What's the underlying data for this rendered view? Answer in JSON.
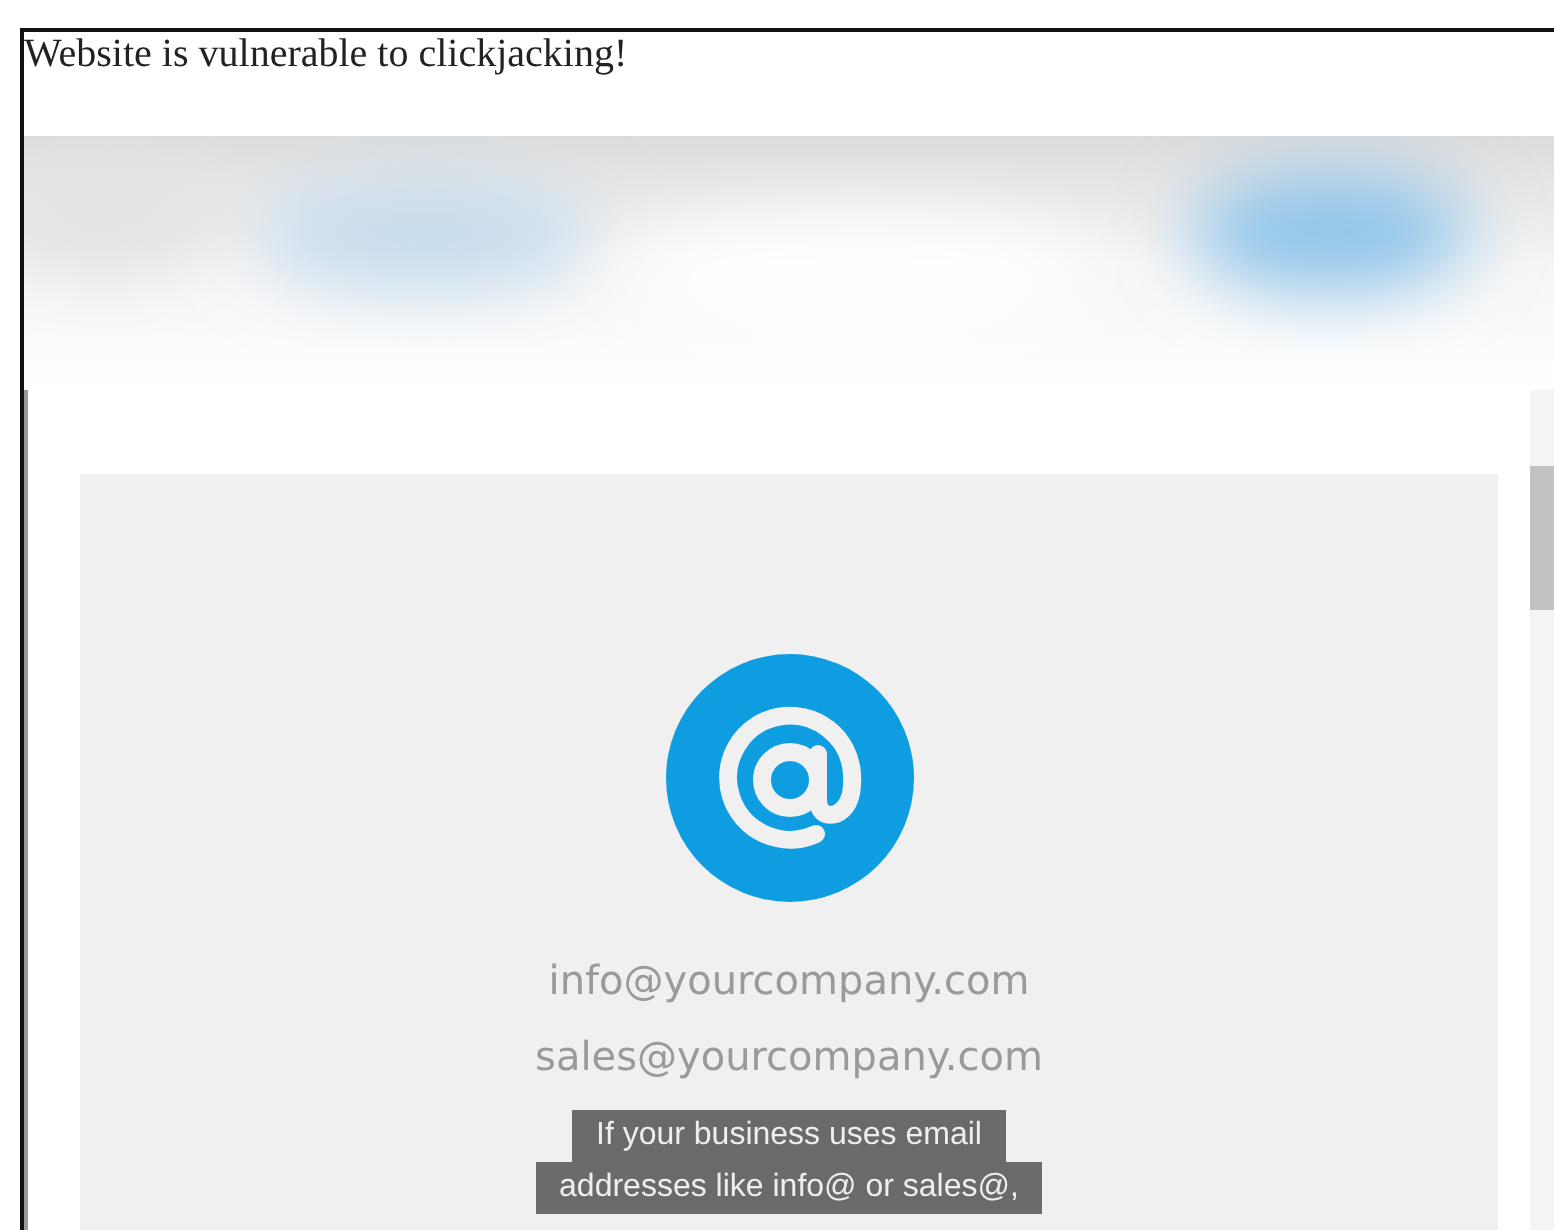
{
  "heading": "Website is vulnerable to clickjacking!",
  "framed_page": {
    "emails": [
      "info@yourcompany.com",
      "sales@yourcompany.com"
    ],
    "caption_lines": [
      "If your business uses email",
      "addresses like info@ or sales@,"
    ]
  }
}
